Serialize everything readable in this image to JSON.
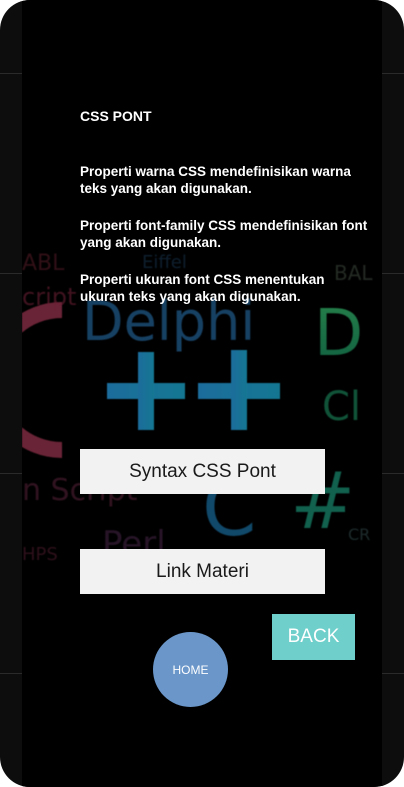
{
  "content": {
    "title": "CSS PONT",
    "paragraphs": [
      "Properti warna CSS mendefinisikan warna teks yang akan digunakan.",
      "Properti font-family CSS mendefinisikan font yang akan digunakan.",
      "Properti ukuran font CSS menentukan ukuran teks yang akan digunakan."
    ]
  },
  "buttons": {
    "syntax_label": "Syntax CSS Pont",
    "link_label": "Link Materi",
    "back_label": "BACK",
    "home_label": "HOME"
  },
  "colors": {
    "back_button": "#6ecfcb",
    "home_button": "#6a96c9",
    "primary_button": "#f2f2f2"
  }
}
